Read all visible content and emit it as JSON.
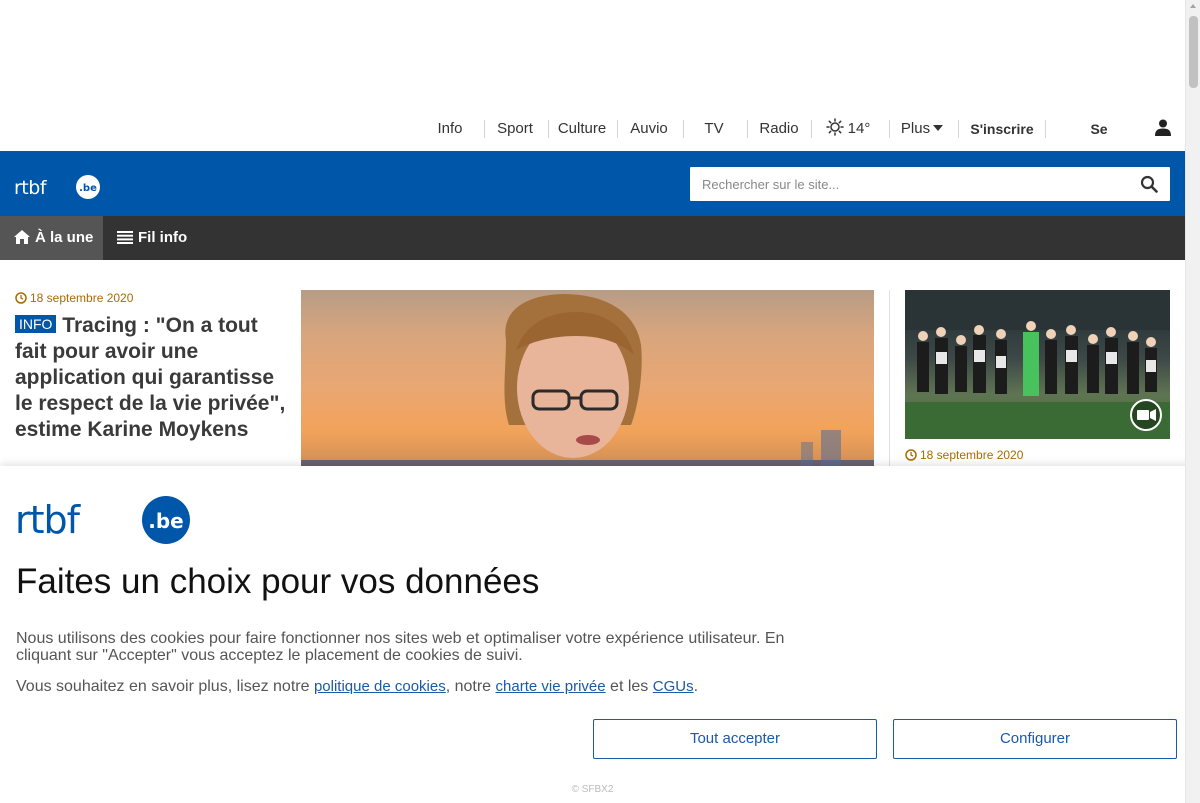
{
  "topnav": {
    "info": "Info",
    "sport": "Sport",
    "culture": "Culture",
    "auvio": "Auvio",
    "tv": "TV",
    "radio": "Radio",
    "weather_temp": "14°",
    "plus": "Plus",
    "signup": "S'inscrire",
    "login": "Se connecter"
  },
  "header": {
    "logo_text": "rtbf",
    "logo_suffix": ".be",
    "search_placeholder": "Rechercher sur le site..."
  },
  "subnav": {
    "home": "À la une",
    "feed": "Fil info"
  },
  "articles": [
    {
      "date": "18 septembre 2020",
      "badge": "INFO",
      "title": "Tracing : \"On a tout fait pour avoir une application qui garantisse le respect de la vie privée\", estime Karine Moykens"
    },
    {
      "date": "18 septembre 2020"
    }
  ],
  "cookie": {
    "title": "Faites un choix pour vos données",
    "text1": "Nous utilisons des cookies pour faire fonctionner nos sites web et optimaliser votre expérience utilisateur. En cliquant sur \"Accepter\" vous acceptez le placement de cookies de suivi.",
    "text2_prefix": "Vous souhaitez en savoir plus, lisez notre ",
    "link_cookies": "politique de cookies",
    "text2_mid1": ", notre ",
    "link_privacy": "charte vie privée",
    "text2_mid2": " et les ",
    "link_cgu": "CGUs",
    "text2_end": ".",
    "accept_all": "Tout accepter",
    "configure": "Configurer",
    "credit": "© SFBX2"
  },
  "colors": {
    "brand_blue": "#0056a8",
    "dark_nav": "#333333",
    "date_orange": "#a96b00"
  }
}
